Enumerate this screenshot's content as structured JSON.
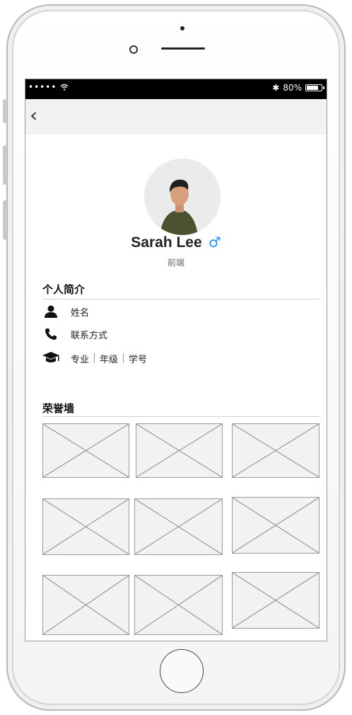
{
  "status_bar": {
    "signal": "••••• ",
    "bluetooth": "✱",
    "battery_text": "80%",
    "battery_level": 0.8
  },
  "nav": {
    "back_icon": "‹"
  },
  "profile": {
    "name": "Sarah Lee",
    "gender_symbol": "♂",
    "role": "前端"
  },
  "intro": {
    "title": "个人简介",
    "name_label": "姓名",
    "contact_label": "联系方式",
    "education": [
      "专业",
      "年级",
      "学号"
    ]
  },
  "honor": {
    "title": "荣誉墙",
    "image_count": 9
  },
  "icons": {
    "name": "user-icon",
    "contact": "phone-icon",
    "education": "graduation-cap-icon"
  },
  "colors": {
    "gender_accent": "#1e90ff",
    "status_bar_bg": "#000000",
    "nav_bg": "#f2f2f2"
  }
}
